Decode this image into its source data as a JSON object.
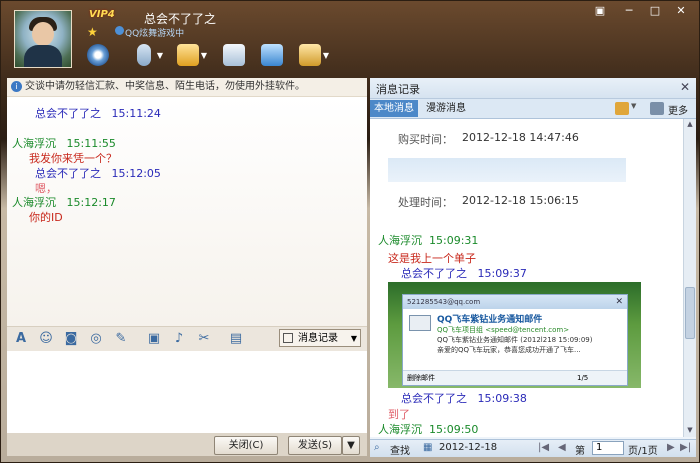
{
  "header": {
    "contact_name": "总会不了了之",
    "vip_badge": "VIP4",
    "sub_status": "QQ炫舞游戏中",
    "window_buttons": [
      "menu-icon",
      "minimize-icon",
      "maximize-icon",
      "close-icon"
    ],
    "toolbar_icons": [
      "video-call-icon",
      "voice-call-icon",
      "send-file-icon",
      "sms-icon",
      "remote-assist-icon",
      "app-menu-icon"
    ]
  },
  "notice": "交谈中请勿轻信汇款、中奖信息、陌生电话，勿使用外挂软件。",
  "chat": [
    {
      "kind": "time",
      "sender": "总会不了了之",
      "time": "15:11:24",
      "color": "blue"
    },
    {
      "kind": "time",
      "sender": "人海浮沉",
      "time": "15:11:55",
      "color": "green"
    },
    {
      "kind": "msg",
      "text": "我发你来凭一个？",
      "color": "red"
    },
    {
      "kind": "time",
      "sender": "总会不了了之",
      "time": "15:12:05",
      "color": "blue"
    },
    {
      "kind": "msg",
      "text": "嗯，",
      "color": "pink"
    },
    {
      "kind": "time",
      "sender": "人海浮沉",
      "time": "15:12:17",
      "color": "green"
    },
    {
      "kind": "msg",
      "text": "你的ID",
      "color": "red"
    }
  ],
  "format_toolbar": {
    "icons": [
      "font-icon",
      "emoji-icon",
      "magic-expression-icon",
      "shake-icon",
      "handwrite-icon",
      "image-icon",
      "music-icon",
      "screenshot-icon",
      "apps-icon"
    ],
    "message_record_label": "消息记录"
  },
  "buttons": {
    "close": "关闭(C)",
    "send": "发送(S)"
  },
  "history": {
    "title": "消息记录",
    "tabs": [
      "本地消息",
      "漫游消息"
    ],
    "more": "更多",
    "order": {
      "purchase_time_label": "购买时间：",
      "purchase_time": "2012-12-18 14:47:46",
      "process_time_label": "处理时间：",
      "process_time": "2012-12-18 15:06:15"
    },
    "messages": [
      {
        "kind": "time",
        "sender": "人海浮沉",
        "time": "15:09:31",
        "color": "green"
      },
      {
        "kind": "msg",
        "text": "这是我上一个单子",
        "color": "red"
      },
      {
        "kind": "time",
        "sender": "总会不了了之",
        "time": "15:09:37",
        "color": "blue"
      },
      {
        "kind": "time",
        "sender": "总会不了了之",
        "time": "15:09:38",
        "color": "blue"
      },
      {
        "kind": "msg",
        "text": "到了",
        "color": "pink"
      },
      {
        "kind": "time",
        "sender": "人海浮沉",
        "time": "15:09:50",
        "color": "green"
      }
    ],
    "mail_popup": {
      "account": "521285543@qq.com",
      "title": "QQ飞车紫钻业务通知邮件",
      "from": "QQ飞车项目组 <speed@tencent.com>",
      "subject": "QQ飞车紫钻业务通知邮件 (2012l218 15:09:09)",
      "snippet": "亲爱的QQ飞车玩家，恭喜您成功开通了飞车...",
      "delete_label": "删除邮件",
      "pager": "1/5"
    },
    "footer": {
      "search_label": "查找",
      "date": "2012-12-18",
      "page_prefix": "第",
      "page_value": "1",
      "page_suffix": "页/1页"
    }
  }
}
